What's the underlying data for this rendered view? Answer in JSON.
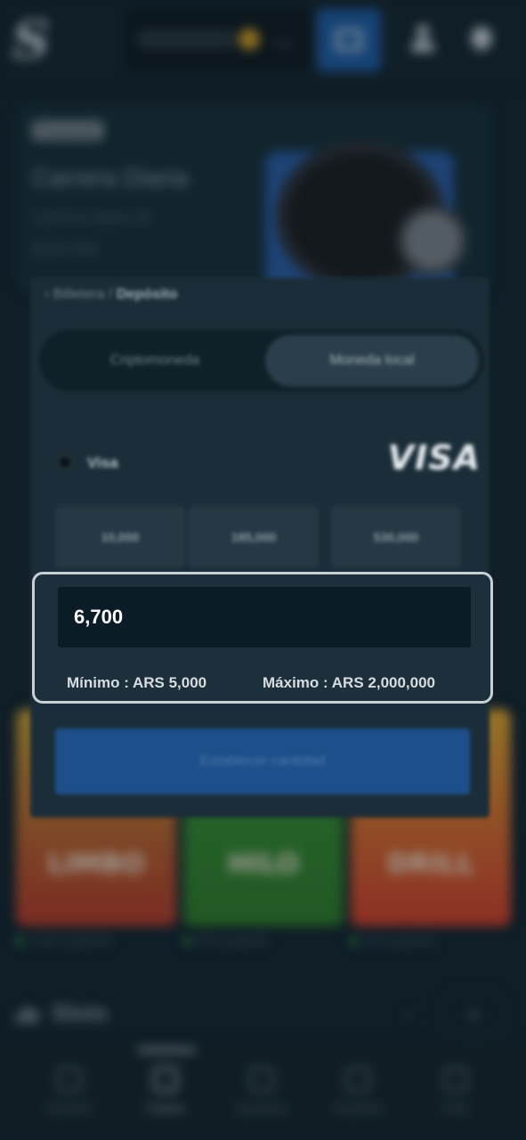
{
  "header": {
    "logo_letter": "S",
    "icons": [
      "wallet-icon",
      "user-icon",
      "bell-icon"
    ]
  },
  "promo": {
    "tag": "Promoción",
    "title": "Carrera Diaria",
    "subtitle_line1": "Carrera diaria de",
    "subtitle_line2": "$100.000"
  },
  "deposit": {
    "breadcrumb_parent": "Billetera",
    "breadcrumb_sep": "/",
    "breadcrumb_current": "Depósito",
    "tabs": [
      {
        "label": "Criptomoneda",
        "active": false
      },
      {
        "label": "Moneda local",
        "active": true
      }
    ],
    "method_label": "Visa",
    "method_logo": "VISA",
    "presets": [
      "10,000",
      "185,000",
      "530,000"
    ],
    "amount_value": "6,700",
    "min_text": "Mínimo : ARS 5,000",
    "max_text": "Máximo : ARS 2,000,000",
    "submit_label": "Establecer cantidad"
  },
  "games": [
    {
      "name": "LIMBO",
      "players": "1,829 jugando"
    },
    {
      "name": "HILO",
      "players": "546 jugando"
    },
    {
      "name": "DRILL",
      "players": "105 jugando"
    }
  ],
  "slots": {
    "title": "Slots",
    "prev": "‹",
    "next": "›"
  },
  "nav": [
    {
      "label": "Explorar",
      "active": false
    },
    {
      "label": "Casino",
      "active": true
    },
    {
      "label": "Apuestas",
      "active": false
    },
    {
      "label": "Deportes",
      "active": false
    },
    {
      "label": "Chat",
      "active": false
    }
  ],
  "colors": {
    "background": "#132530",
    "accent_blue": "#1e5ea8",
    "focus_border": "#c7d0d6",
    "online_dot": "#3fbf5a"
  }
}
